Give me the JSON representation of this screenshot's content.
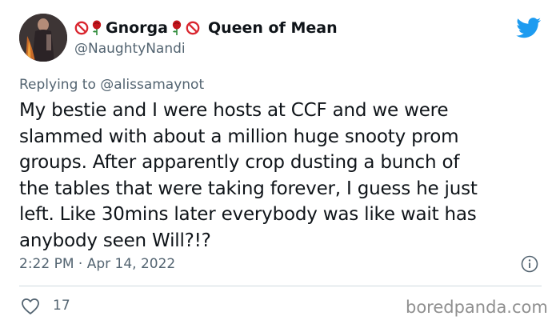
{
  "author": {
    "name_prefix": "Gnorga",
    "name_suffix": "Queen of Mean",
    "handle": "@NaughtyNandi"
  },
  "reply": {
    "prefix": "Replying to",
    "mention": "@alissamaynot"
  },
  "tweet": {
    "lines": [
      "My bestie and I were hosts at CCF and we were",
      "slammed with about a million huge snooty prom",
      "groups. After apparently crop dusting a bunch of",
      "the tables that were taking forever, I guess he just",
      "left. Like 30mins later everybody was like wait has",
      "anybody seen Will?!?"
    ],
    "timestamp": "2:22 PM · Apr 14, 2022",
    "likes": "17"
  },
  "watermark": "boredpanda.com",
  "icons": {
    "no_symbol": "no-entry-sign-icon",
    "rose": "rose-icon",
    "brand": "twitter-bird-icon",
    "info": "info-icon",
    "like": "heart-icon"
  },
  "colors": {
    "twitter_blue": "#1d9bf0",
    "no_symbol_red": "#d9262f",
    "rose_red": "#c4151c",
    "secondary_text": "#536471"
  }
}
